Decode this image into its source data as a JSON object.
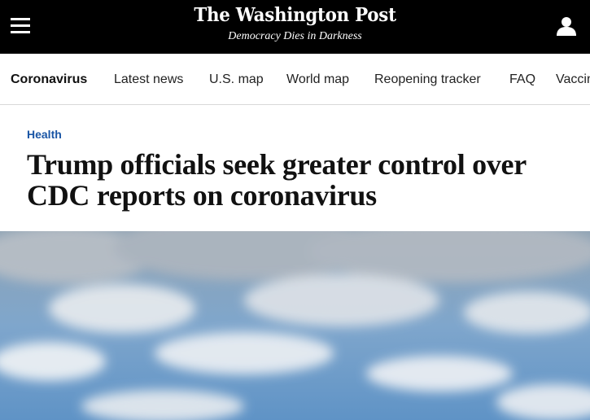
{
  "header": {
    "logo_text": "The Washington Post",
    "tagline": "Democracy Dies in Darkness",
    "menu_icon": "hamburger-menu-icon",
    "account_icon": "user-account-icon"
  },
  "nav": {
    "items": [
      {
        "label": "Coronavirus",
        "active": true
      },
      {
        "label": "Latest news",
        "active": false
      },
      {
        "label": "U.S. map",
        "active": false
      },
      {
        "label": "World map",
        "active": false
      },
      {
        "label": "Reopening tracker",
        "active": false
      },
      {
        "label": "FAQ",
        "active": false
      },
      {
        "label": "Vaccines",
        "active": false
      }
    ]
  },
  "article": {
    "section": "Health",
    "headline": "Trump officials seek greater control over CDC reports on coronavirus"
  },
  "colors": {
    "header_bg": "#000000",
    "kicker": "#1955a5",
    "sky": "#6f9ecb"
  }
}
